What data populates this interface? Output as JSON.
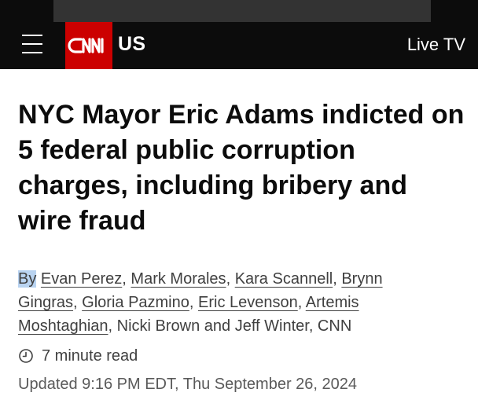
{
  "header": {
    "section_label": "US",
    "live_tv_label": "Live TV",
    "logo_text": "CNN",
    "logo_color": "#cc0000",
    "background_color": "#0c0c0c"
  },
  "article": {
    "headline": "NYC Mayor Eric Adams indicted on 5 federal public corruption charges, including bribery and wire fraud",
    "byline": {
      "prefix": "By",
      "linked_authors": [
        "Evan Perez",
        "Mark Morales",
        "Kara Scannell",
        "Brynn Gingras",
        "Gloria Pazmino",
        "Eric Levenson",
        "Artemis Moshtaghian"
      ],
      "separator": ", ",
      "trailing": ", Nicki Brown and Jeff Winter, CNN"
    },
    "read_time": "7 minute read",
    "updated": "Updated 9:16 PM EDT, Thu September 26, 2024"
  },
  "icons": {
    "menu": "hamburger-menu-icon",
    "clock": "clock-icon"
  }
}
